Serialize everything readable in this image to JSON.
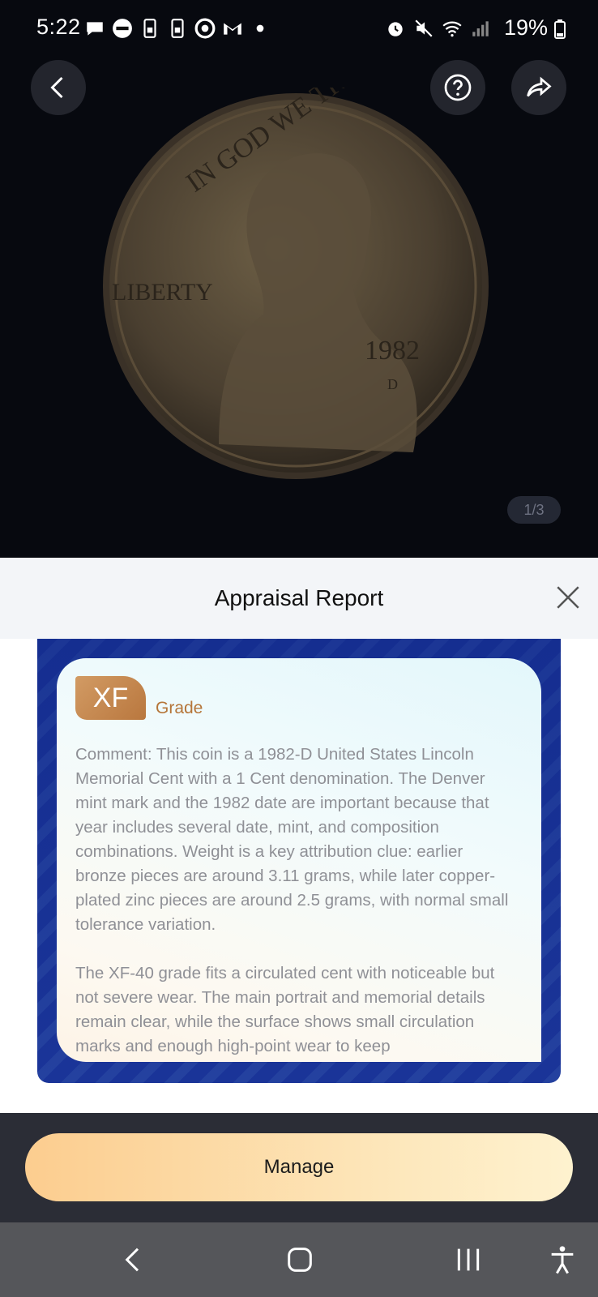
{
  "status_bar": {
    "time": "5:22",
    "battery": "19%",
    "left_icons": [
      "chat-icon",
      "news-icon",
      "sim-icon",
      "sim-icon",
      "chrome-icon",
      "gmail-icon",
      "dot-icon"
    ],
    "right_icons": [
      "alarm-icon",
      "mute-icon",
      "wifi-icon",
      "signal-icon",
      "battery-icon"
    ]
  },
  "photo": {
    "coin_description_icon": "coin-photo",
    "pager": "1/3"
  },
  "report": {
    "title": "Appraisal Report",
    "grade_code": "XF",
    "grade_label": "Grade",
    "comment_p1": "Comment: This coin is a 1982-D United States Lincoln Memorial Cent with a 1 Cent denomination. The Denver mint mark and the 1982 date are important because that year includes several date, mint, and composition combinations. Weight is a key attribution clue: earlier bronze pieces are around 3.11 grams, while later copper-plated zinc pieces are around 2.5 grams, with normal small tolerance variation.",
    "comment_p2": "The XF-40 grade fits a circulated cent with noticeable but not severe wear. The main portrait and memorial details remain clear, while the surface shows small circulation marks and enough high-point wear to keep"
  },
  "actions": {
    "manage_label": "Manage"
  },
  "colors": {
    "accent_gold": "#b57539",
    "frame_blue": "#1a3498",
    "manage_button": "#fccd8f"
  }
}
